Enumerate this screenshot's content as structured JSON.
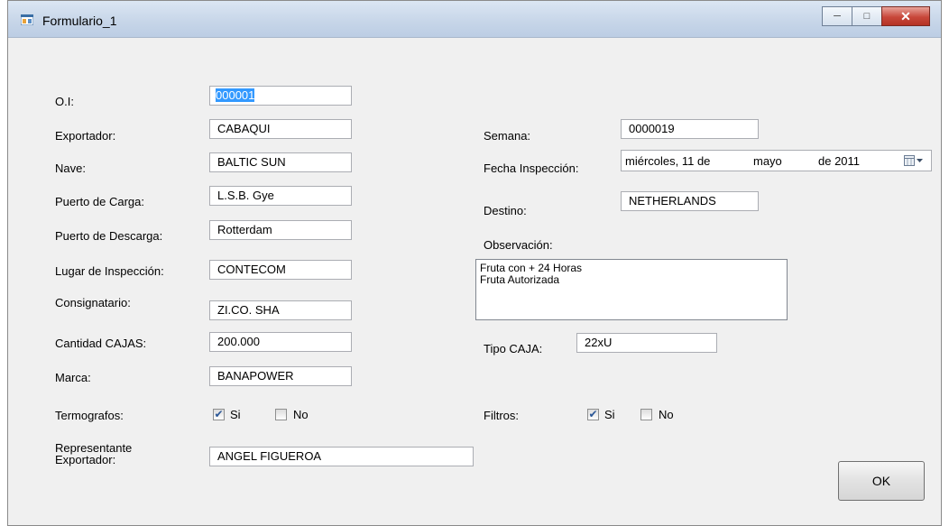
{
  "window": {
    "title": "Formulario_1"
  },
  "labels": {
    "oi": "O.I:",
    "exportador": "Exportador:",
    "nave": "Nave:",
    "puerto_carga": "Puerto de Carga:",
    "puerto_descarga": "Puerto de Descarga:",
    "lugar_inspeccion": "Lugar de Inspección:",
    "consignatario": "Consignatario:",
    "cantidad_cajas": "Cantidad CAJAS:",
    "marca": "Marca:",
    "termografos": "Termografos:",
    "representante_1": "Representante",
    "representante_2": "Exportador:",
    "semana": "Semana:",
    "fecha_inspeccion": "Fecha Inspección:",
    "destino": "Destino:",
    "observacion": "Observación:",
    "tipo_caja": "Tipo CAJA:",
    "filtros": "Filtros:"
  },
  "fields": {
    "oi": "000001",
    "exportador": "CABAQUI",
    "nave": "BALTIC SUN",
    "puerto_carga": "L.S.B. Gye",
    "puerto_descarga": "Rotterdam",
    "lugar_inspeccion": "CONTECOM",
    "consignatario": "ZI.CO. SHA",
    "cantidad_cajas": "200.000",
    "marca": "BANAPOWER",
    "representante": "ANGEL FIGUEROA",
    "semana": "0000019",
    "destino": "NETHERLANDS",
    "tipo_caja": "22xU",
    "observacion_line1": "Fruta con + 24 Horas",
    "observacion_line2": "Fruta Autorizada"
  },
  "fecha": {
    "weekday_day": "miércoles, 11 de",
    "month": "mayo",
    "year": "de 2011"
  },
  "termografos": {
    "si_label": "Si",
    "no_label": "No",
    "si_checked": true,
    "no_checked": false
  },
  "filtros": {
    "si_label": "Si",
    "no_label": "No",
    "si_checked": true,
    "no_checked": false
  },
  "ok_button": "OK",
  "colors": {
    "selection": "#3399ff",
    "close_button": "#c8473a"
  }
}
